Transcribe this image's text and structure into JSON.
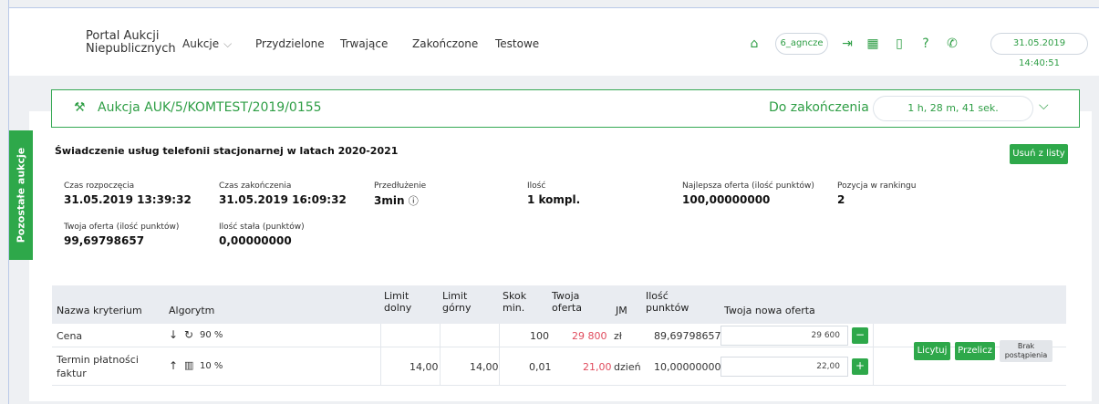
{
  "header": {
    "logo_line1": "Portal Aukcji",
    "logo_line2": "Niepublicznych",
    "nav": [
      "Aukcje",
      "Przydzielone",
      "Trwające",
      "Zakończone",
      "Testowe"
    ],
    "user_label": "6_agncze",
    "datetime": "31.05.2019 14:40:51",
    "icons": [
      "home-icon",
      "logout-icon",
      "calculator-icon",
      "book-icon",
      "help-icon",
      "phone-icon",
      "chevron-down-icon"
    ]
  },
  "auction": {
    "title": "Aukcja AUK/5/KOMTEST/2019/0155",
    "ending_label": "Do zakończenia",
    "remaining": "1 h, 28 m, 41 sek."
  },
  "side_tab_label": "Pozostałe aukcje",
  "service_title": "Świadczenie usług telefonii stacjonarnej w latach 2020-2021",
  "remove_button": "Usuń z listy",
  "info": {
    "start_label": "Czas rozpoczęcia",
    "start_value": "31.05.2019 13:39:32",
    "end_label": "Czas zakończenia",
    "end_value": "31.05.2019 16:09:32",
    "ext_label": "Przedłużenie",
    "ext_value": "3min",
    "qty_label": "Ilość",
    "qty_value": "1 kompl.",
    "best_label": "Najlepsza oferta (ilość punktów)",
    "best_value": "100,00000000",
    "rank_label": "Pozycja w rankingu",
    "rank_value": "2",
    "your_label": "Twoja oferta (ilość punktów)",
    "your_value": "99,69798657",
    "fixed_label": "Ilość stała (punktów)",
    "fixed_value": "0,00000000"
  },
  "table": {
    "headers": {
      "name": "Nazwa kryterium",
      "algo": "Algorytm",
      "limit_low_1": "Limit",
      "limit_low_2": "dolny",
      "limit_high_1": "Limit",
      "limit_high_2": "górny",
      "step_1": "Skok",
      "step_2": "min.",
      "offer_1": "Twoja",
      "offer_2": "oferta",
      "unit": "JM",
      "points_1": "Ilość",
      "points_2": "punktów",
      "new_offer": "Twoja nowa oferta"
    },
    "rows": [
      {
        "name": "Cena",
        "algo_arrow": "↓",
        "algo_text": "90 %",
        "limit_low": "",
        "limit_high": "",
        "step": "100",
        "offer": "29 800",
        "unit": "zł",
        "points": "89,69798657",
        "new_offer": "29 600",
        "btn": "−"
      },
      {
        "name1": "Termin płatności",
        "name2": "faktur",
        "algo_arrow": "↑",
        "algo_text": "10 %",
        "limit_low": "14,00",
        "limit_high": "14,00",
        "step": "0,01",
        "offer": "21,00",
        "unit": "dzień",
        "points": "10,00000000",
        "new_offer": "22,00",
        "btn": "+"
      }
    ],
    "bid_button": "Licytuj",
    "recalc_button": "Przelicz",
    "no_step_1": "Brak",
    "no_step_2": "postąpienia"
  }
}
